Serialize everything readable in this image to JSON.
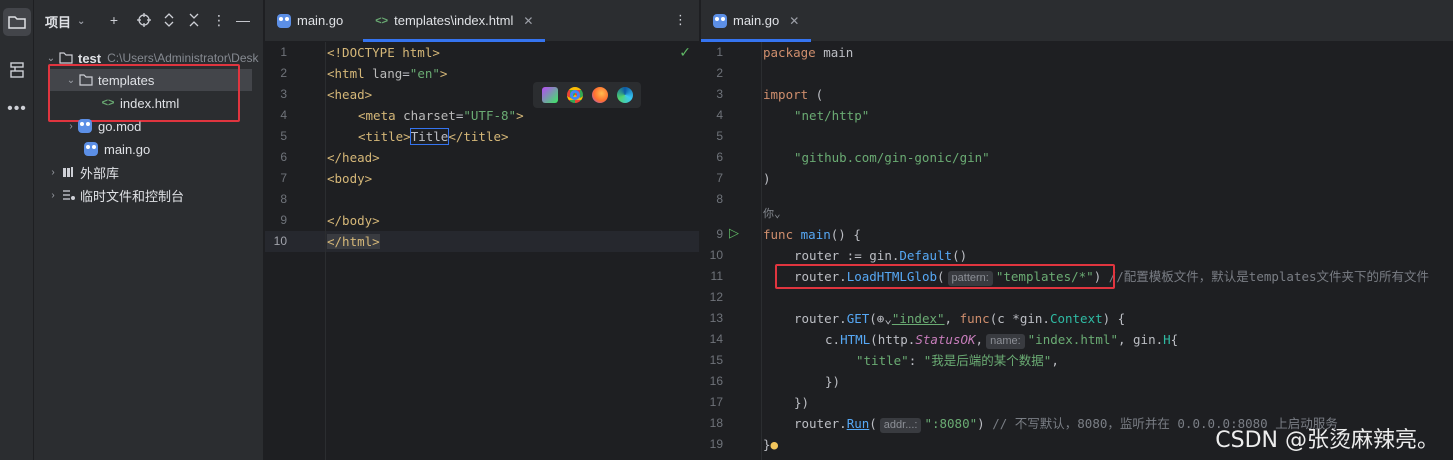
{
  "project_panel": {
    "title": "项目",
    "tree": {
      "root": {
        "name": "test",
        "path": "C:\\Users\\Administrator\\Desk"
      },
      "templates": "templates",
      "index_html": "index.html",
      "go_mod": "go.mod",
      "main_go": "main.go",
      "external_libs": "外部库",
      "scratches": "临时文件和控制台"
    }
  },
  "left_editor": {
    "tabs": [
      {
        "label": "main.go",
        "icon": "gopher-icon"
      },
      {
        "label": "templates\\index.html",
        "icon": "html-tag-icon"
      }
    ],
    "line_numbers": [
      "1",
      "2",
      "3",
      "4",
      "5",
      "6",
      "7",
      "8",
      "9",
      "10"
    ],
    "lines": {
      "l1": "<!DOCTYPE html>",
      "l2a": "<html ",
      "l2b": "lang",
      "l2c": "=",
      "l2d": "\"en\"",
      "l2e": ">",
      "l3": "<head>",
      "l4a": "<meta ",
      "l4b": "charset",
      "l4c": "=",
      "l4d": "\"UTF-8\"",
      "l4e": ">",
      "l5a": "<title>",
      "l5b": "Title",
      "l5c": "</title>",
      "l6": "</head>",
      "l7": "<body>",
      "l9": "</body>",
      "l10": "</html>"
    }
  },
  "right_editor": {
    "tab": {
      "label": "main.go",
      "icon": "gopher-icon"
    },
    "line_numbers": [
      "1",
      "2",
      "3",
      "4",
      "5",
      "6",
      "7",
      "8",
      "9",
      "10",
      "11",
      "12",
      "13",
      "14",
      "15",
      "16",
      "17",
      "18",
      "19"
    ],
    "code": {
      "l1a": "package ",
      "l1b": "main",
      "l3a": "import",
      "l3b": " (",
      "l4": "\"net/http\"",
      "l6": "\"github.com/gin-gonic/gin\"",
      "l7": ")",
      "l8": "你",
      "l9a": "func ",
      "l9b": "main",
      "l9c": "() {",
      "l10a": "router := ",
      "l10b": "gin",
      "l10c": ".",
      "l10d": "Default",
      "l10e": "()",
      "l11a": "router.",
      "l11b": "LoadHTMLGlob",
      "l11c": "(",
      "l11hint": "pattern:",
      "l11d": "\"templates/*\"",
      "l11e": ")",
      "l11cmt": "//配置模板文件，默认是templates文件夹下的所有文件",
      "l13a": "router.",
      "l13b": "GET",
      "l13c": "(",
      "l13d": "\"index\"",
      "l13e": ", ",
      "l13f": "func",
      "l13g": "(c *",
      "l13h": "gin",
      "l13i": ".",
      "l13j": "Context",
      "l13k": ") {",
      "l14a": "c.",
      "l14b": "HTML",
      "l14c": "(http.",
      "l14d": "StatusOK",
      "l14e": ",",
      "l14hint": "name:",
      "l14f": "\"index.html\"",
      "l14g": ", gin.",
      "l14h": "H",
      "l14i": "{",
      "l15a": "\"title\"",
      "l15b": ": ",
      "l15c": "\"我是后端的某个数据\"",
      "l15d": ",",
      "l16": "})",
      "l17": "})",
      "l18a": "router.",
      "l18b": "Run",
      "l18c": "(",
      "l18hint": "addr...:",
      "l18d": "\":8080\"",
      "l18e": ")",
      "l18cmt": "// 不写默认，8080，监听并在 0.0.0.0:8080 上启动服务",
      "l19": "}"
    }
  },
  "watermark": "CSDN @张烫麻辣亮。",
  "colors": {
    "accent": "#3574f0",
    "highlight_box": "#e0353f",
    "keyword": "#cf8e6d",
    "string": "#6aab73",
    "function": "#56a8f5",
    "tag": "#d5b778"
  }
}
